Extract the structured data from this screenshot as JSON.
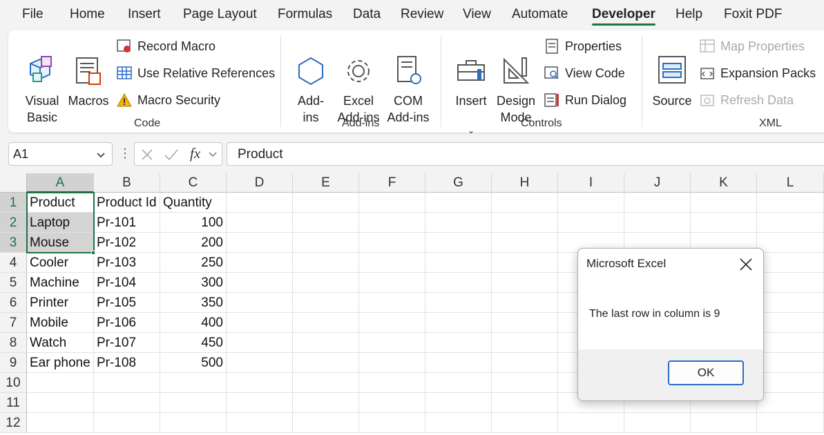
{
  "menu": {
    "tabs": [
      "File",
      "Home",
      "Insert",
      "Page Layout",
      "Formulas",
      "Data",
      "Review",
      "View",
      "Automate",
      "Developer",
      "Help",
      "Foxit PDF"
    ],
    "active_tab": "Developer"
  },
  "ribbon": {
    "code": {
      "label": "Code",
      "visual_basic": "Visual\nBasic",
      "macros": "Macros",
      "record_macro": "Record Macro",
      "use_relative_references": "Use Relative References",
      "macro_security": "Macro Security"
    },
    "addins": {
      "label": "Add-ins",
      "addins": "Add-\nins",
      "excel_addins": "Excel\nAdd-ins",
      "com_addins": "COM\nAdd-ins"
    },
    "controls": {
      "label": "Controls",
      "insert": "Insert",
      "design_mode": "Design\nMode",
      "properties": "Properties",
      "view_code": "View Code",
      "run_dialog": "Run Dialog"
    },
    "xml": {
      "label": "XML",
      "source": "Source",
      "map_properties": "Map Properties",
      "expansion_packs": "Expansion Packs",
      "refresh_data": "Refresh Data"
    }
  },
  "formula_bar": {
    "name_box": "A1",
    "fx_label": "fx",
    "content": "Product"
  },
  "sheet": {
    "columns": [
      "A",
      "B",
      "C",
      "D",
      "E",
      "F",
      "G",
      "H",
      "I",
      "J",
      "K",
      "L"
    ],
    "rows": [
      "1",
      "2",
      "3",
      "4",
      "5",
      "6",
      "7",
      "8",
      "9",
      "10",
      "11",
      "12"
    ],
    "data": [
      [
        "Product",
        "Product Id",
        "Quantity"
      ],
      [
        "Laptop",
        "Pr-101",
        "100"
      ],
      [
        "Mouse",
        "Pr-102",
        "200"
      ],
      [
        "Cooler",
        "Pr-103",
        "250"
      ],
      [
        "Machine",
        "Pr-104",
        "300"
      ],
      [
        "Printer",
        "Pr-105",
        "350"
      ],
      [
        "Mobile",
        "Pr-106",
        "400"
      ],
      [
        "Watch",
        "Pr-107",
        "450"
      ],
      [
        "Ear phone",
        "Pr-108",
        "500"
      ]
    ]
  },
  "dialog": {
    "title": "Microsoft Excel",
    "message": "The last row in column is 9",
    "ok_label": "OK"
  },
  "colors": {
    "accent": "#1e7145",
    "dialog_button_border": "#2b6cc4"
  }
}
